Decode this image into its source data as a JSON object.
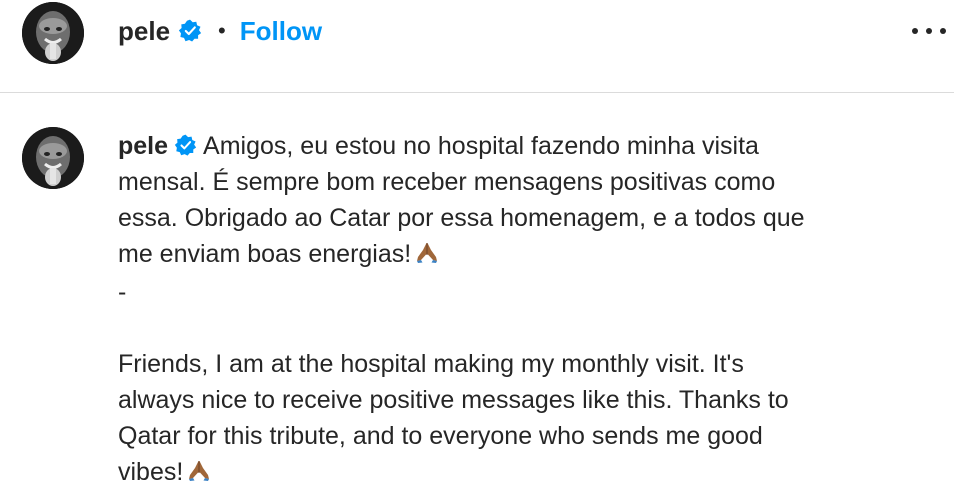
{
  "header": {
    "username": "pele",
    "separator": "•",
    "follow_label": "Follow",
    "avatar_icon": "profile-photo",
    "verified_icon": "verified-badge-icon",
    "more_icon": "more-options-icon"
  },
  "comment": {
    "username": "pele",
    "line1": "Amigos, eu estou no hospital fazendo minha visita",
    "line2": "mensal. É sempre bom receber mensagens positivas como",
    "line3": "essa. Obrigado ao Catar por essa homenagem, e a todos que",
    "line4": "me enviam boas energias!",
    "dash": "-",
    "en_line1": "Friends, I am at the hospital making my monthly visit. It's",
    "en_line2": "always nice to receive positive messages like this. Thanks to",
    "en_line3": "Qatar for this tribute, and to everyone who sends me good",
    "en_line4": "vibes!",
    "emoji_icon": "folded-hands-icon"
  },
  "colors": {
    "accent": "#0095f6",
    "text": "#262626",
    "divider": "#dbdbdb"
  }
}
